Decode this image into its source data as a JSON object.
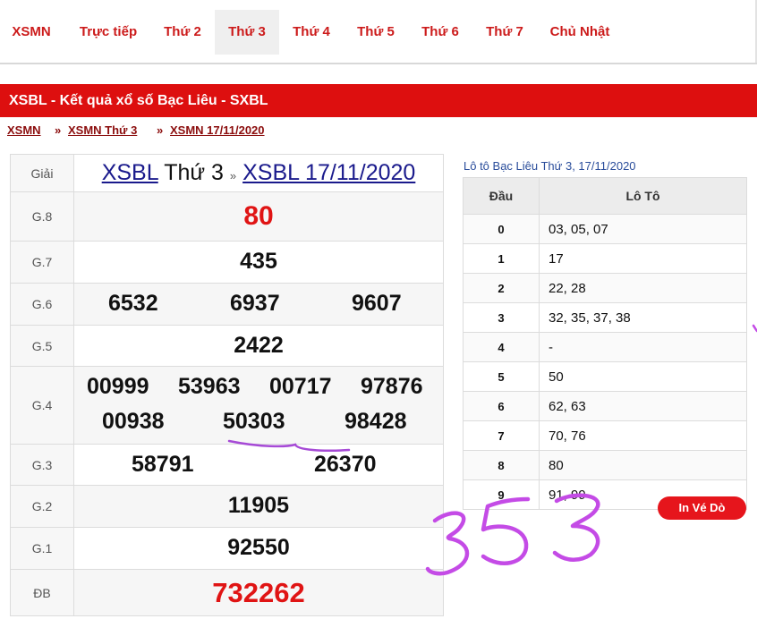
{
  "nav": {
    "tabs": [
      {
        "label": "XSMN"
      },
      {
        "label": "Trực tiếp"
      },
      {
        "label": "Thứ 2"
      },
      {
        "label": "Thứ 3"
      },
      {
        "label": "Thứ 4"
      },
      {
        "label": "Thứ 5"
      },
      {
        "label": "Thứ 6"
      },
      {
        "label": "Thứ 7"
      },
      {
        "label": "Chủ Nhật"
      }
    ],
    "active_tab": "Thứ 3"
  },
  "header": {
    "title": "XSBL - Kết quả xổ số Bạc Liêu - SXBL"
  },
  "breadcrumb": {
    "items": [
      "XSMN",
      "XSMN Thứ 3",
      "XSMN 17/11/2020"
    ],
    "separator": "»"
  },
  "results": {
    "label_header": "Giải",
    "title_link1": "XSBL",
    "title_text": " Thứ 3 ",
    "title_sep": "»",
    "title_link2": "XSBL 17/11/2020",
    "rows": [
      {
        "label": "G.8",
        "values": [
          "80"
        ]
      },
      {
        "label": "G.7",
        "values": [
          "435"
        ]
      },
      {
        "label": "G.6",
        "values": [
          "6532",
          "6937",
          "9607"
        ]
      },
      {
        "label": "G.5",
        "values": [
          "2422"
        ]
      },
      {
        "label": "G.4",
        "values": [
          "00999",
          "53963",
          "00717",
          "97876",
          "00938",
          "50303",
          "98428"
        ]
      },
      {
        "label": "G.3",
        "values": [
          "58791",
          "26370"
        ]
      },
      {
        "label": "G.2",
        "values": [
          "11905"
        ]
      },
      {
        "label": "G.1",
        "values": [
          "92550"
        ]
      },
      {
        "label": "ĐB",
        "values": [
          "732262"
        ]
      }
    ]
  },
  "loto": {
    "caption": "Lô tô Bạc Liêu Thứ 3, 17/11/2020",
    "headers": [
      "Đầu",
      "Lô Tô"
    ],
    "rows": [
      {
        "dau": "0",
        "loto": "03, 05, 07"
      },
      {
        "dau": "1",
        "loto": "17"
      },
      {
        "dau": "2",
        "loto": "22, 28"
      },
      {
        "dau": "3",
        "loto": "32, 35, 37, 38"
      },
      {
        "dau": "4",
        "loto": "-"
      },
      {
        "dau": "5",
        "loto": "50"
      },
      {
        "dau": "6",
        "loto": "62, 63"
      },
      {
        "dau": "7",
        "loto": "70, 76"
      },
      {
        "dau": "8",
        "loto": "80"
      },
      {
        "dau": "9",
        "loto": "91, 99"
      }
    ]
  },
  "print_button": {
    "label": "In Vé Dò"
  },
  "handwriting": {
    "text": "353",
    "color": "#c44be6",
    "underline_color": "#a64ad6"
  },
  "colors": {
    "brand_red": "#dd0f0f",
    "nav_red": "#cc1b1b",
    "link_blue": "#1a1a8c"
  }
}
